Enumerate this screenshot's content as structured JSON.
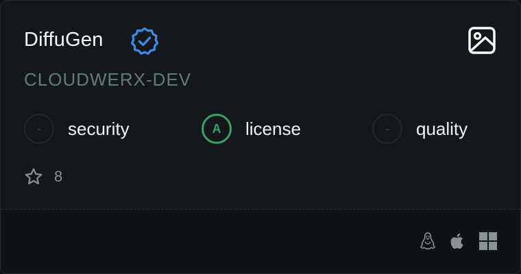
{
  "card": {
    "title": "DiffuGen",
    "publisher": "CLOUDWERX-DEV",
    "verified": true,
    "scores": [
      {
        "grade": "-",
        "label": "security",
        "status": "none"
      },
      {
        "grade": "A",
        "label": "license",
        "status": "good"
      },
      {
        "grade": "-",
        "label": "quality",
        "status": "none"
      }
    ],
    "stars": "8",
    "platforms": [
      "linux-icon",
      "apple-icon",
      "windows-icon"
    ]
  },
  "colors": {
    "background": "#14181b",
    "footer": "#101315",
    "title": "#ffffff",
    "publisher": "#5f7d77",
    "verified": "#3d8be8",
    "grade_good": "#35a36a",
    "muted": "#8a9296"
  }
}
